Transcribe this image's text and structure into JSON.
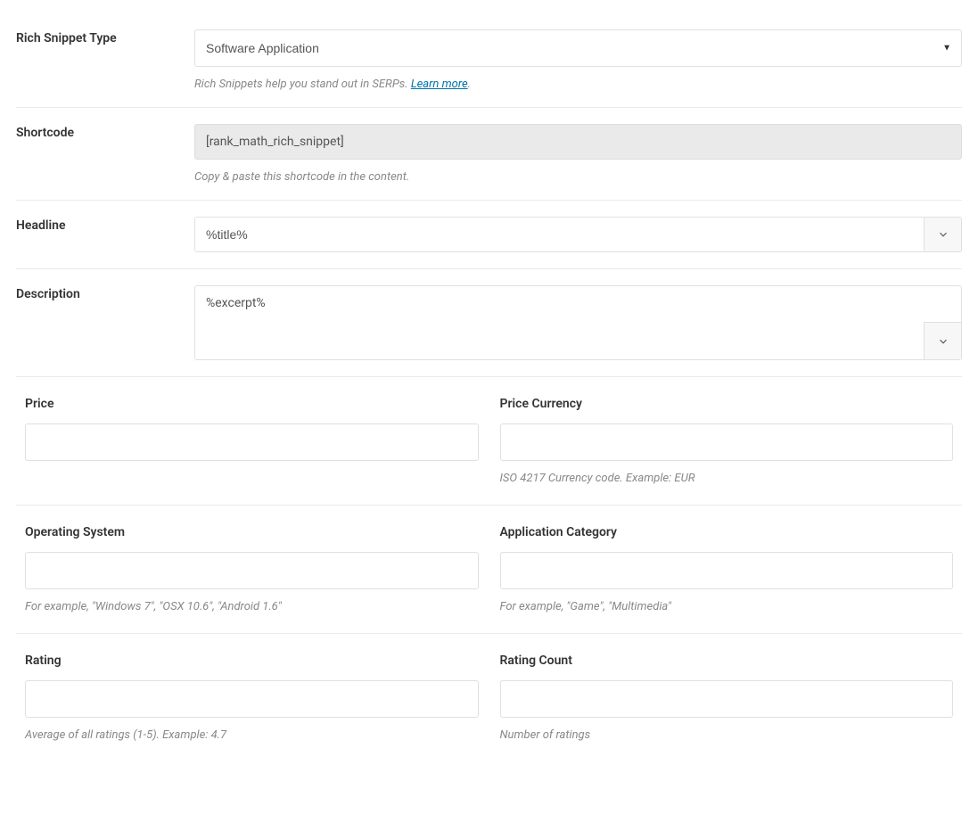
{
  "richSnippetType": {
    "label": "Rich Snippet Type",
    "selected": "Software Application",
    "help_prefix": "Rich Snippets help you stand out in SERPs. ",
    "learn_more": "Learn more",
    "help_suffix": "."
  },
  "shortcode": {
    "label": "Shortcode",
    "value": "[rank_math_rich_snippet]",
    "help": "Copy & paste this shortcode in the content."
  },
  "headline": {
    "label": "Headline",
    "value": "%title%"
  },
  "description": {
    "label": "Description",
    "value": "%excerpt%"
  },
  "price": {
    "label": "Price",
    "value": ""
  },
  "priceCurrency": {
    "label": "Price Currency",
    "value": "",
    "help": "ISO 4217 Currency code. Example: EUR"
  },
  "operatingSystem": {
    "label": "Operating System",
    "value": "",
    "help": "For example, \"Windows 7\", \"OSX 10.6\", \"Android 1.6\""
  },
  "applicationCategory": {
    "label": "Application Category",
    "value": "",
    "help": "For example, \"Game\", \"Multimedia\""
  },
  "rating": {
    "label": "Rating",
    "value": "",
    "help": "Average of all ratings (1-5). Example: 4.7"
  },
  "ratingCount": {
    "label": "Rating Count",
    "value": "",
    "help": "Number of ratings"
  }
}
